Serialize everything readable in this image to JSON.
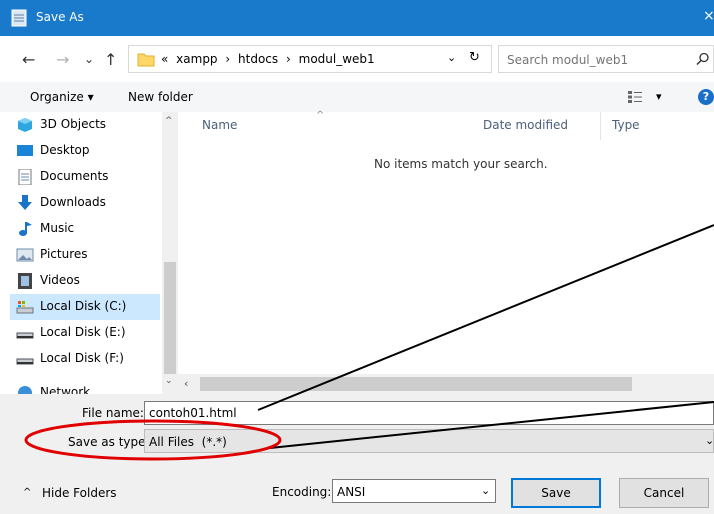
{
  "window": {
    "title": "Save As",
    "close": "×"
  },
  "nav": {
    "back": "←",
    "forward": "→",
    "recent": "⌄",
    "up": "↑",
    "breadcrumb": [
      "«",
      "xampp",
      "›",
      "htdocs",
      "›",
      "modul_web1"
    ],
    "refresh": "↻",
    "search_placeholder": "Search modul_web1"
  },
  "toolbar": {
    "organize": "Organize ▾",
    "new_folder": "New folder",
    "view": "▾",
    "help": "?"
  },
  "tree": {
    "items": [
      {
        "label": "3D Objects",
        "icon": "3d-objects-icon"
      },
      {
        "label": "Desktop",
        "icon": "desktop-icon"
      },
      {
        "label": "Documents",
        "icon": "documents-icon"
      },
      {
        "label": "Downloads",
        "icon": "downloads-icon"
      },
      {
        "label": "Music",
        "icon": "music-icon"
      },
      {
        "label": "Pictures",
        "icon": "pictures-icon"
      },
      {
        "label": "Videos",
        "icon": "videos-icon"
      },
      {
        "label": "Local Disk (C:)",
        "icon": "drive-c-icon"
      },
      {
        "label": "Local Disk (E:)",
        "icon": "drive-icon"
      },
      {
        "label": "Local Disk (F:)",
        "icon": "drive-icon"
      },
      {
        "label": "Network",
        "icon": "network-icon"
      }
    ]
  },
  "columns": {
    "name": "Name",
    "date": "Date modified",
    "type": "Type",
    "sort": "^"
  },
  "empty_message": "No items match your search.",
  "form": {
    "file_name_label": "File name:",
    "file_name_value": "contoh01.html",
    "save_type_label": "Save as type:",
    "save_type_value": "All Files  (*.*)",
    "encoding_label": "Encoding:",
    "encoding_value": "ANSI",
    "save": "Save",
    "cancel": "Cancel",
    "hide_folders": "Hide Folders"
  },
  "colors": {
    "title_bar": "#1979ca",
    "selection": "#cce8ff",
    "annotation": "#e00000",
    "default_button": "#0078d7"
  }
}
